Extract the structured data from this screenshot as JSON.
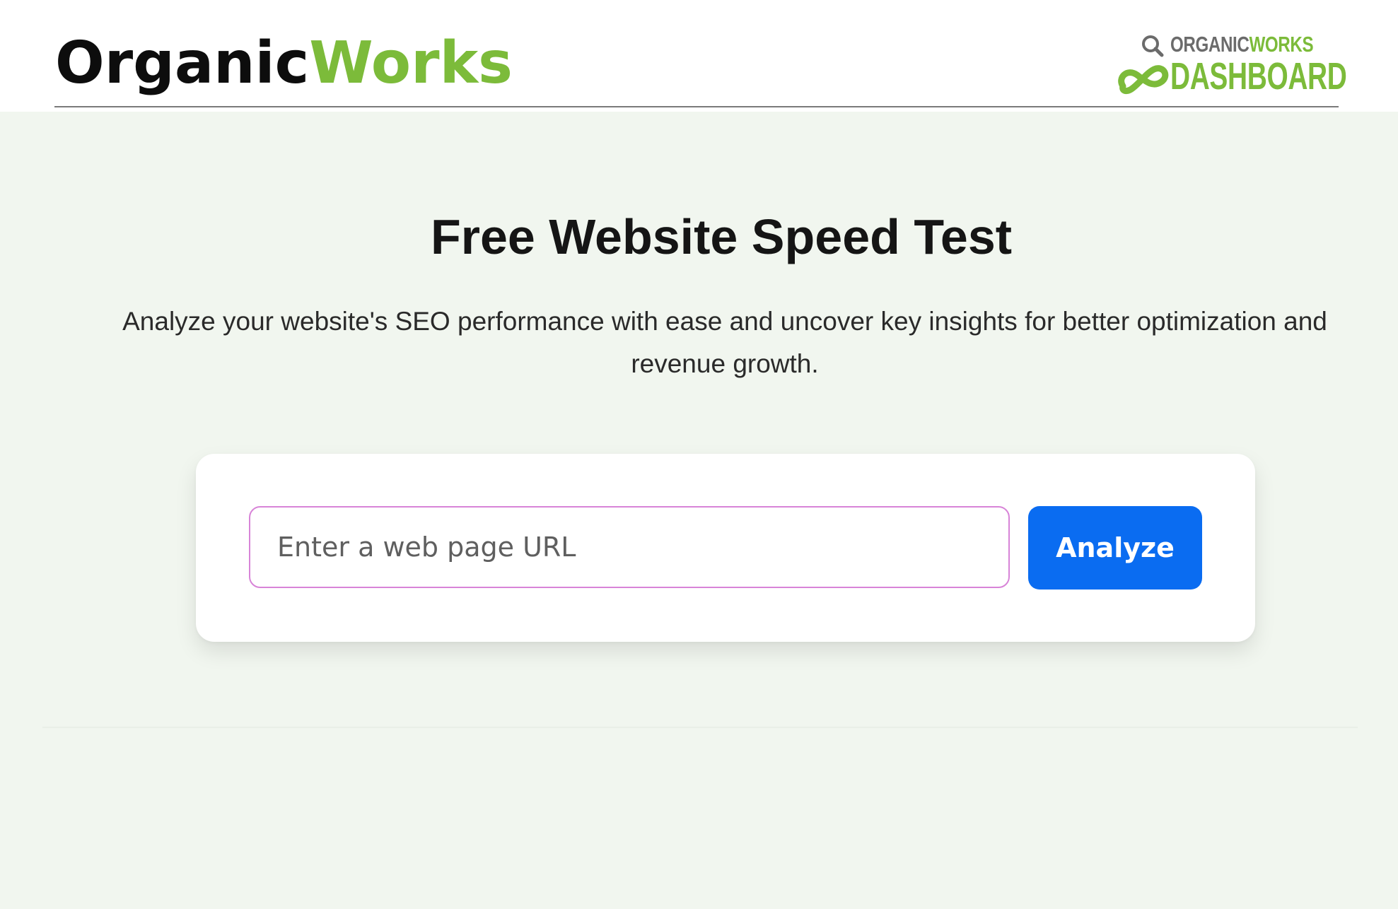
{
  "header": {
    "brand_part1": "Organic",
    "brand_part2": "Works",
    "dashboard_logo": {
      "line1_part1": "ORGANIC",
      "line1_part2": "WORKS",
      "line2": "DASHBOARD",
      "icon": "magnifier-infinity-icon"
    }
  },
  "hero": {
    "title": "Free Website Speed Test",
    "subtitle": "Analyze your website's SEO performance with ease and  uncover key insights for better optimization and revenue growth."
  },
  "form": {
    "url_placeholder": "Enter a web page URL",
    "url_value": "",
    "analyze_label": "Analyze"
  },
  "colors": {
    "brand_green": "#7cbb3a",
    "button_blue": "#0a6cf1",
    "page_bg": "#f1f6ef",
    "input_border": "#d884d8"
  }
}
